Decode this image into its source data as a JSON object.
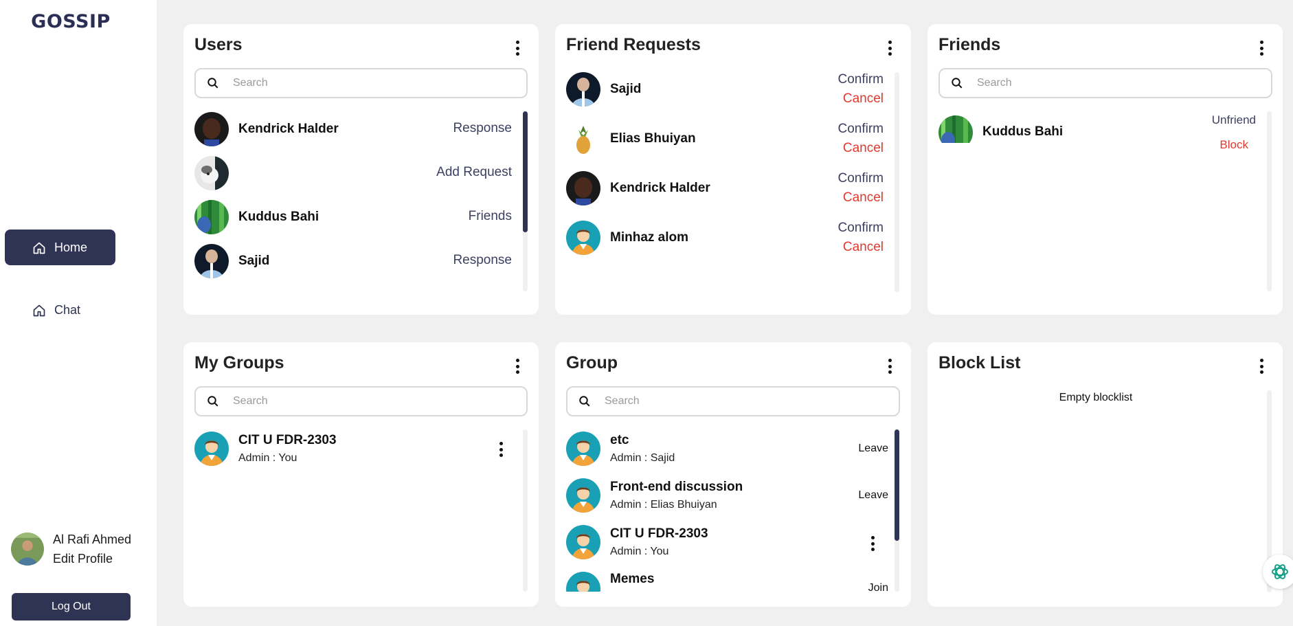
{
  "app": {
    "logo": "GOSSIP"
  },
  "nav": [
    {
      "label": "Home",
      "icon": "home-icon",
      "active": true
    },
    {
      "label": "Chat",
      "icon": "home-icon",
      "active": false
    }
  ],
  "profile": {
    "name": "Al Rafi Ahmed",
    "edit": "Edit Profile",
    "logout": "Log Out"
  },
  "users": {
    "title": "Users",
    "search_placeholder": "Search",
    "items": [
      {
        "name": "Kendrick Halder",
        "action": "Response"
      },
      {
        "name": "",
        "action": "Add Request"
      },
      {
        "name": "Kuddus Bahi",
        "action": "Friends"
      },
      {
        "name": "Sajid",
        "action": "Response"
      }
    ]
  },
  "friend_requests": {
    "title": "Friend Requests",
    "confirm": "Confirm",
    "cancel": "Cancel",
    "items": [
      {
        "name": "Sajid"
      },
      {
        "name": "Elias Bhuiyan"
      },
      {
        "name": "Kendrick Halder"
      },
      {
        "name": "Minhaz alom"
      }
    ]
  },
  "friends": {
    "title": "Friends",
    "search_placeholder": "Search",
    "items": [
      {
        "name": "Kuddus Bahi",
        "unfriend": "Unfriend",
        "block": "Block"
      }
    ]
  },
  "my_groups": {
    "title": "My Groups",
    "search_placeholder": "Search",
    "items": [
      {
        "name": "CIT U FDR-2303",
        "admin": "Admin : You"
      }
    ]
  },
  "group": {
    "title": "Group",
    "search_placeholder": "Search",
    "items": [
      {
        "name": "etc",
        "admin": "Admin : Sajid",
        "action": "Leave"
      },
      {
        "name": "Front-end discussion",
        "admin": "Admin : Elias Bhuiyan",
        "action": "Leave"
      },
      {
        "name": "CIT U FDR-2303",
        "admin": "Admin : You",
        "action": ""
      },
      {
        "name": "Memes",
        "admin": "",
        "action": "Join"
      }
    ]
  },
  "block_list": {
    "title": "Block List",
    "empty": "Empty blocklist"
  },
  "colors": {
    "accent": "#2f3454",
    "cancel": "#e0392e",
    "background": "#f0f0f0"
  }
}
